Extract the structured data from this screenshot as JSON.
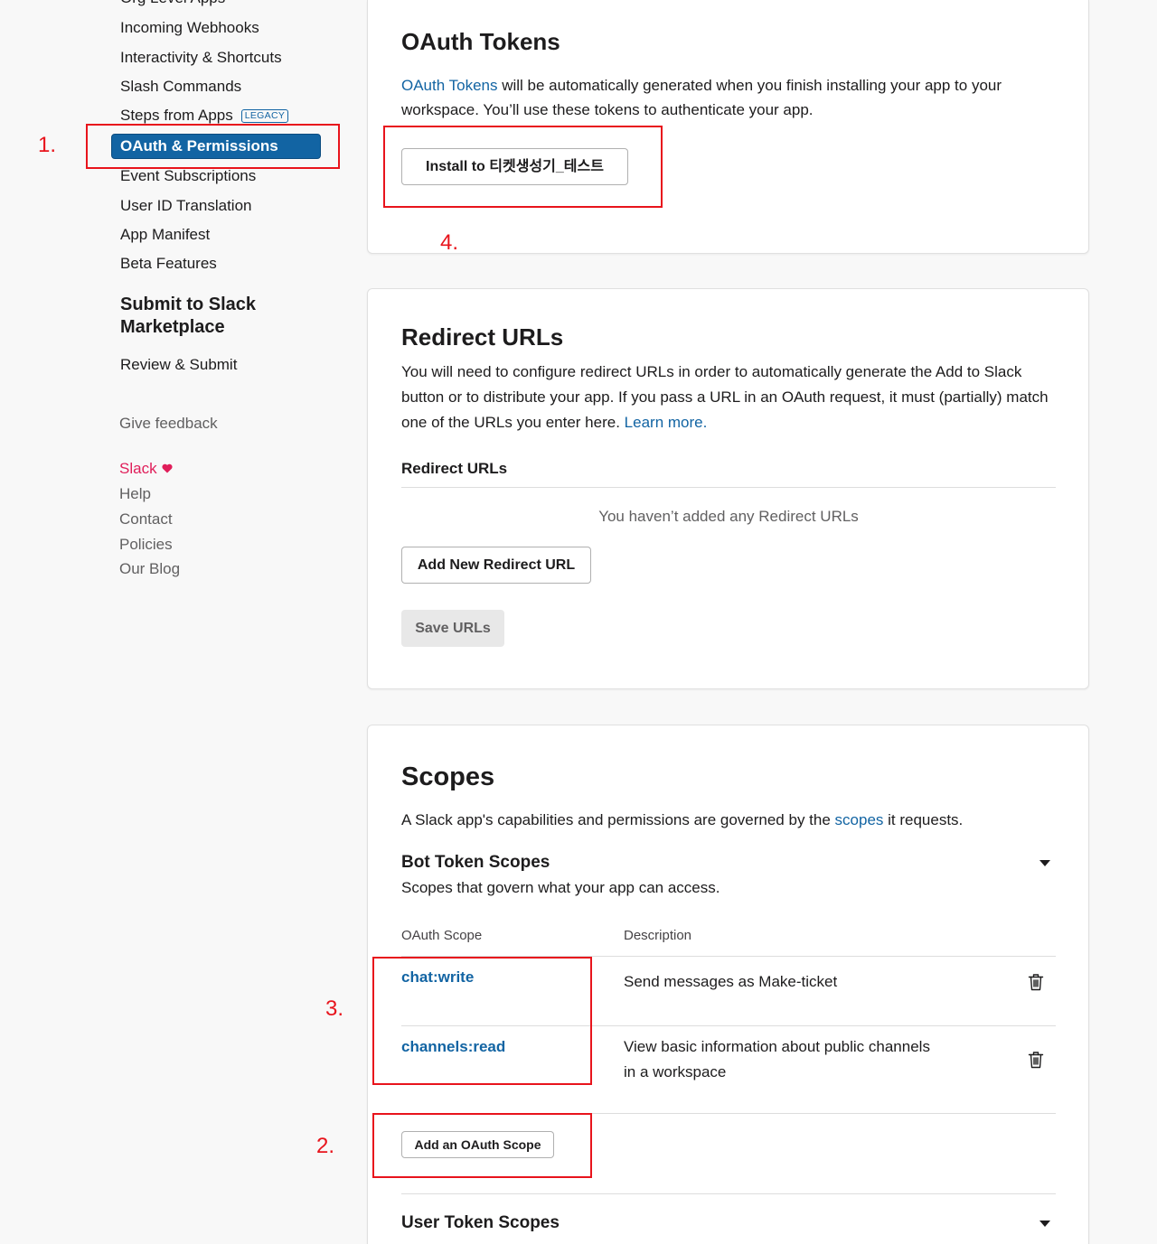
{
  "sidebar": {
    "nav_items": [
      {
        "label": "Org Level Apps"
      },
      {
        "label": "Incoming Webhooks"
      },
      {
        "label": "Interactivity & Shortcuts"
      },
      {
        "label": "Slash Commands"
      },
      {
        "label": "Steps from Apps",
        "badge": "LEGACY"
      },
      {
        "label": "OAuth & Permissions",
        "active": true
      },
      {
        "label": "Event Subscriptions"
      },
      {
        "label": "User ID Translation"
      },
      {
        "label": "App Manifest"
      },
      {
        "label": "Beta Features"
      }
    ],
    "submit_section": {
      "title": "Submit to Slack Marketplace",
      "items": [
        {
          "label": "Review & Submit"
        }
      ]
    },
    "feedback_label": "Give feedback",
    "footer_links": [
      {
        "label": "Slack",
        "icon": "heart-icon"
      },
      {
        "label": "Help"
      },
      {
        "label": "Contact"
      },
      {
        "label": "Policies"
      },
      {
        "label": "Our Blog"
      }
    ]
  },
  "oauth_tokens": {
    "title": "OAuth Tokens",
    "description": {
      "link": "OAuth Tokens",
      "text": " will be automatically generated when you finish installing your app to your workspace. You’ll use these tokens to authenticate your app."
    },
    "install_button_label": "Install to 티켓생성기_테스트"
  },
  "redirect_urls": {
    "title": "Redirect URLs",
    "description": "You will need to configure redirect URLs in order to automatically generate the Add to Slack button or to distribute your app. If you pass a URL in an OAuth request, it must (partially) match one of the URLs you enter here.",
    "learn_more": "Learn more.",
    "list_label": "Redirect URLs",
    "empty_message": "You haven’t added any Redirect URLs",
    "add_button_label": "Add New Redirect URL",
    "save_button_label": "Save URLs",
    "save_button_disabled": true
  },
  "scopes": {
    "title": "Scopes",
    "description": {
      "before": "A Slack app's capabilities and permissions are governed by the ",
      "link": "scopes",
      "after": " it requests."
    },
    "bot_token_scopes": {
      "title": "Bot Token Scopes",
      "subtitle": "Scopes that govern what your app can access.",
      "columns": [
        "OAuth Scope",
        "Description"
      ],
      "rows": [
        {
          "scope": "chat:write",
          "description": "Send messages as Make-ticket"
        },
        {
          "scope": "channels:read",
          "description": "View basic information about public channels in a workspace"
        }
      ],
      "add_button_label": "Add an OAuth Scope"
    },
    "user_token_scopes": {
      "title": "User Token Scopes"
    }
  },
  "annotations": [
    {
      "label": "1."
    },
    {
      "label": "2."
    },
    {
      "label": "3."
    },
    {
      "label": "4."
    }
  ],
  "icons": {
    "delete": "trash-icon",
    "collapse": "caret-down-icon",
    "heart": "heart-icon"
  },
  "colors": {
    "text": "#1d1c1d",
    "link": "#1264a3",
    "muted": "#616061",
    "brand_pink": "#e01e5a",
    "annotation": "#e8141c",
    "divider": "#dddddd",
    "page_background": "#f8f8f8"
  }
}
